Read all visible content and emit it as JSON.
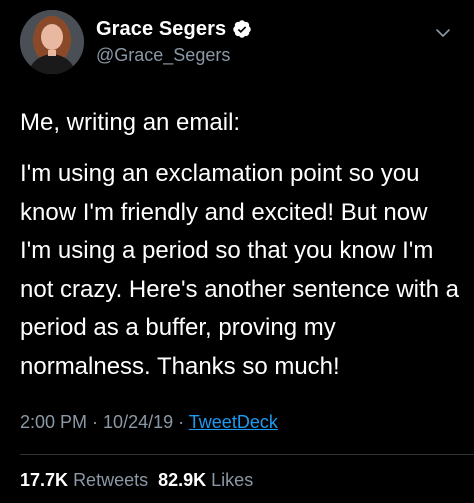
{
  "author": {
    "display_name": "Grace Segers",
    "handle": "@Grace_Segers",
    "verified": true
  },
  "tweet": {
    "intro": "Me, writing an email:",
    "body": "I'm using an exclamation point so you know I'm friendly and excited! But now I'm using a period so that you know I'm not crazy. Here's another sentence with a period as a buffer, proving my normalness. Thanks so much!",
    "time": "2:00 PM",
    "date": "10/24/19",
    "separator": " · ",
    "source": "TweetDeck"
  },
  "stats": {
    "retweets_count": "17.7K",
    "retweets_label": "Retweets",
    "likes_count": "82.9K",
    "likes_label": "Likes"
  },
  "icons": {
    "verified": "verified-badge-icon",
    "menu": "chevron-down-icon"
  },
  "colors": {
    "background": "#000000",
    "text": "#ffffff",
    "secondary": "#8b98a5",
    "link": "#1d9bf0"
  }
}
